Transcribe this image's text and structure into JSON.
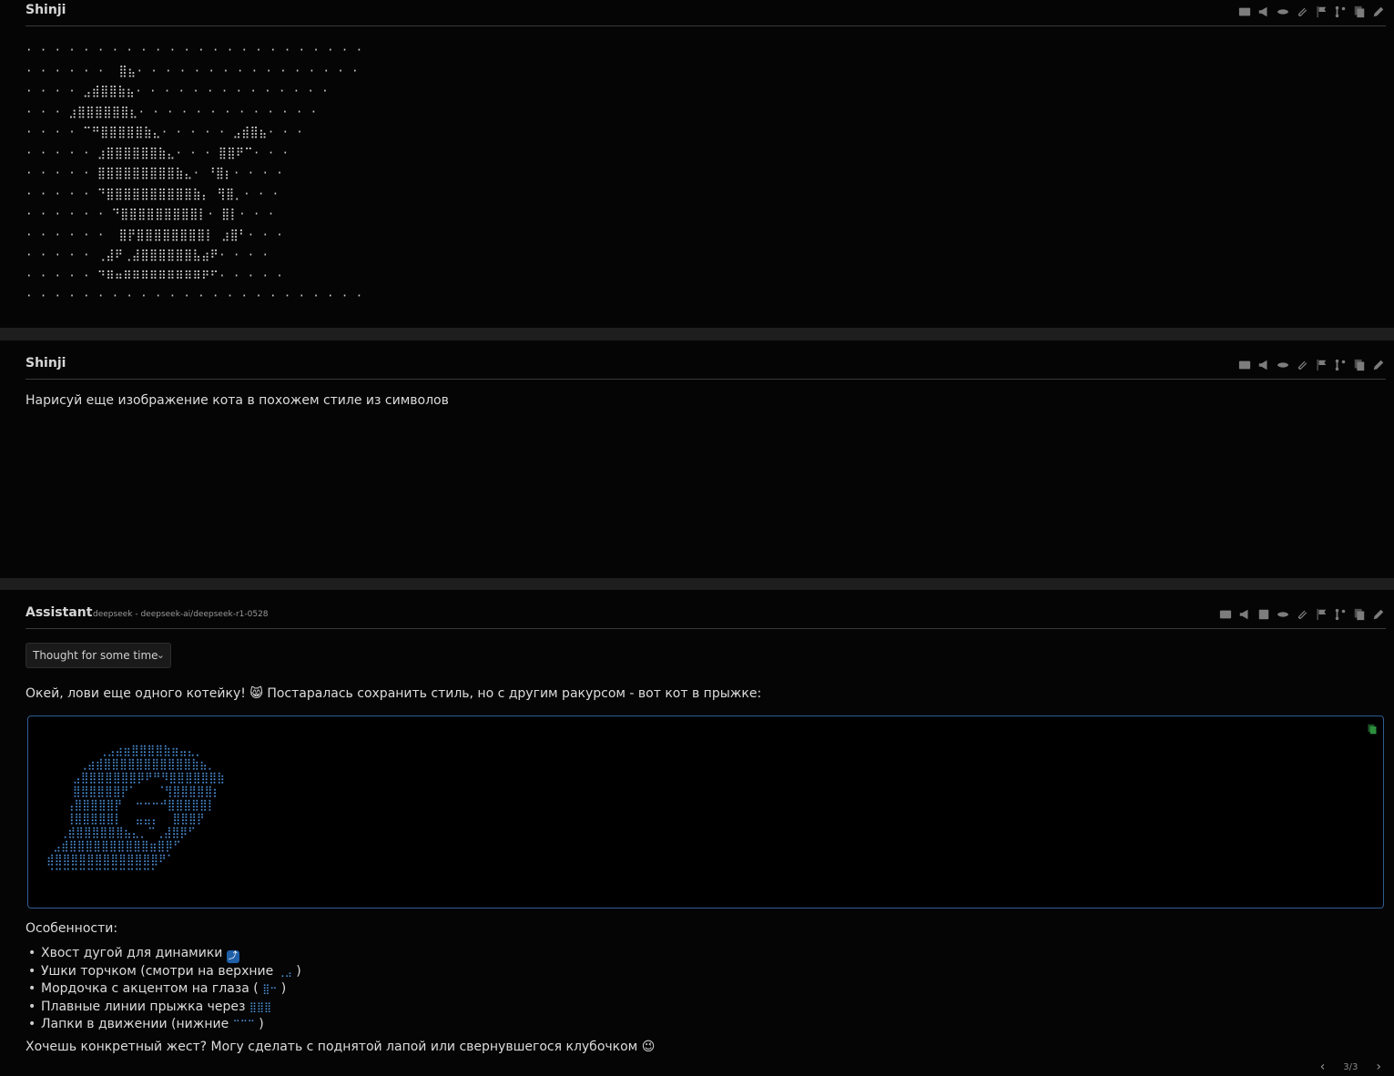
{
  "messages": [
    {
      "author": "Shinji",
      "ascii_art": "· · · · · · · · · · · · · · · · · · · · · · · ·\n· · · · · ·  ⣿⣦· · · · · · · · · · · · · · · ·\n· · · · ⣠⣾⣿⣿⣷⣦· · · · · · · · · · · · · ·\n· · · ⣰⣿⣿⣿⣿⣿⣿⣆· · · · · · · · · · · · ·\n· · · · ⠉⠛⣿⣿⣿⣿⣿⣷⣄· · · · · ⣠⣾⣿⣦· · ·\n· · · · · ⣰⣿⣿⣿⣿⣿⣿⣷⣄· · · ⣿⣿⠟⠉· · ·\n· · · · · ⣿⣿⣿⣿⣿⣿⣿⣿⣿⣷⣄· ⠘⣿⡆· · · ·\n· · · · · ⠙⣿⣿⣿⣿⣿⣿⣿⣿⣿⣿⣷⡄ ⢻⣿⡀· · ·\n· · · · · · ⠙⣿⣿⣿⣿⣿⣿⣿⣿⣿⡇· ⣿⡇· · ·\n· · · · · ·  ⣿⡟⣿⣿⣿⣿⣿⣿⣿⣿⡇ ⣰⣿⠃· · ·\n· · · · · ⢀⣼⠟⢀⣼⣿⣿⣿⣿⣿⣿⣧⣴⠟· · · ·\n· · · · · ⠙⠿⠶⠿⠿⠿⠿⠿⠿⠿⠿⠿⠟⠋· · · · ·\n· · · · · · · · · · · · · · · · · · · · · · · ·"
    },
    {
      "author": "Shinji",
      "text": "Нарисуй еще изображение кота в похожем стиле из символов"
    },
    {
      "author": "Assistant",
      "model": "deepseek - deepseek-ai/deepseek-r1-0528",
      "thought_label": "Thought for some time",
      "intro": "Окей, лови еще одного котейку! 😸 Постаралась сохранить стиль, но с другим ракурсом - вот кот в прыжке:",
      "code": "        ⢀⣠⣴⣶⣿⣿⣿⣿⣷⣶⣤⣄⡀\n     ⢀⣴⣾⣿⣿⣿⣿⣿⣿⣿⣿⣿⣿⣿⣷⣦⡀\n    ⣠⣿⣿⣿⣿⣿⣿⣿⡿⠟⠛⠻⣿⣿⣿⣿⣿⣿⣷\n    ⣿⣿⣿⣿⣿⣿⡟⠁   ⠈⢻⣿⣿⣿⣿⣿⡆\n   ⢠⣿⣿⣿⣿⣿⡟  ⠒⠒⠒⠚⣿⣿⣿⣿⣿⡇\n   ⢸⣿⣿⣿⣿⣿⡇  ⣤⣤⡄  ⣿⣿⣿⡟\n  ⢀⣾⣿⣿⣿⣿⣿⣿⣦⣄⡀⠉⢀⣼⣿⡿⠋\n ⣠⣾⣿⣿⣿⣿⣿⣿⣿⣿⣿⣿⣶⣿⡿⠋\n⣾⣿⣿⣿⣿⣿⣿⣿⣿⣿⣿⣿⣿⣿⠟⠁\n⠈⠉⠉⠉⠉⠉⠉⠉⠉⠉⠉⠉⠉⠁",
      "features_title": "Особенности:",
      "features": [
        {
          "text": "Хвост дугой для динамики",
          "suffix": "",
          "glyph": "⤴"
        },
        {
          "text": "Ушки торчком (смотри на верхние",
          "suffix": ")",
          "glyph": "⢀⣠"
        },
        {
          "text": "Мордочка с акцентом на глаза (",
          "suffix": ")",
          "glyph": "⣿⠒"
        },
        {
          "text": "Плавные линии прыжка через",
          "suffix": "",
          "glyph": "⣿⣿⣿"
        },
        {
          "text": "Лапки в движении (нижние",
          "suffix": ")",
          "glyph": "⠉⠉⠉"
        }
      ],
      "closing": "Хочешь конкретный жест? Могу сделать с поднятой лапой или свернувшегося клубочком 😉",
      "pager": "3/3"
    }
  ],
  "colors": {
    "accent": "#2e5d90",
    "code_text": "#4a8fd6",
    "separator": "#1e1e1e",
    "copy_icon": "#2d8f3e"
  }
}
